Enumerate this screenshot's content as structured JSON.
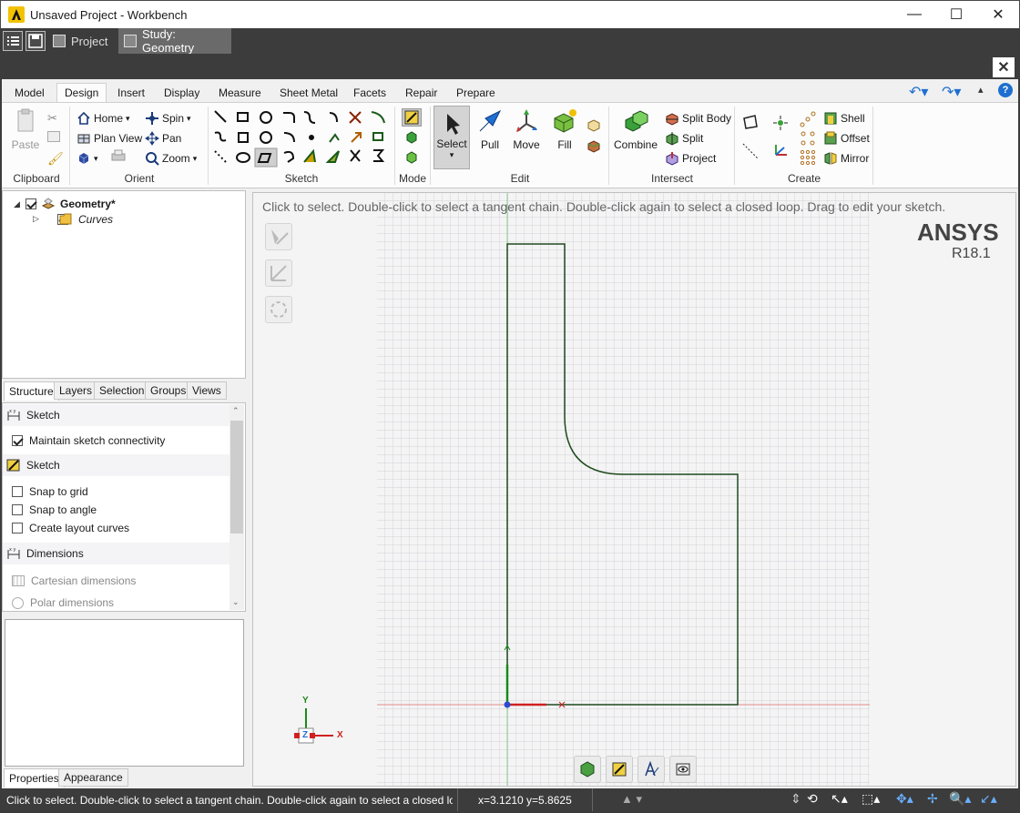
{
  "window": {
    "title": "Unsaved Project - Workbench",
    "controls": [
      "—",
      "☐",
      "✕"
    ]
  },
  "project_tabs": [
    {
      "label": "Project",
      "active": false
    },
    {
      "label": "Study: Geometry",
      "active": true
    }
  ],
  "ribbon_tabs": [
    "Model",
    "Design",
    "Insert",
    "Display",
    "Measure",
    "Sheet Metal",
    "Facets",
    "Repair",
    "Prepare"
  ],
  "active_ribbon_tab": "Design",
  "ribbon": {
    "clipboard": {
      "label": "Clipboard",
      "paste": "Paste"
    },
    "orient": {
      "label": "Orient",
      "home": "Home",
      "plan_view": "Plan View",
      "spin": "Spin",
      "pan": "Pan",
      "zoom": "Zoom"
    },
    "sketch": {
      "label": "Sketch"
    },
    "mode": {
      "label": "Mode"
    },
    "edit": {
      "label": "Edit",
      "select": "Select",
      "pull": "Pull",
      "move": "Move",
      "fill": "Fill"
    },
    "intersect": {
      "label": "Intersect",
      "combine": "Combine",
      "split_body": "Split Body",
      "split": "Split",
      "project": "Project"
    },
    "create": {
      "label": "Create",
      "shell": "Shell",
      "offset": "Offset",
      "mirror": "Mirror"
    }
  },
  "tree": {
    "root": "Geometry*",
    "child": "Curves"
  },
  "panel_tabs": [
    "Structure",
    "Layers",
    "Selection",
    "Groups",
    "Views"
  ],
  "options": {
    "sketch_header_1": "Sketch",
    "maintain_connectivity": "Maintain sketch connectivity",
    "sketch_header_2": "Sketch",
    "snap_grid": "Snap to grid",
    "snap_angle": "Snap to angle",
    "layout_curves": "Create layout curves",
    "dimensions_header": "Dimensions",
    "cartesian": "Cartesian dimensions",
    "polar": "Polar dimensions"
  },
  "bottom_tabs": [
    "Properties",
    "Appearance"
  ],
  "viewport": {
    "hint": "Click to select. Double-click to select a tangent chain. Double-click again to select a closed loop. Drag to edit your sketch.",
    "brand": "ANSYS",
    "version": "R18.1",
    "axis_x": "X",
    "axis_y": "Y",
    "axis_z": "Z"
  },
  "status": {
    "message": "Click to select. Double-click to select a tangent chain. Double-click again to select a closed loop. Dra",
    "coords": "x=3.1210  y=5.8625"
  },
  "colors": {
    "chrome": "#3c3c3c",
    "sketch_line": "#1e4a1e",
    "accent_blue": "#1e6fd0"
  }
}
